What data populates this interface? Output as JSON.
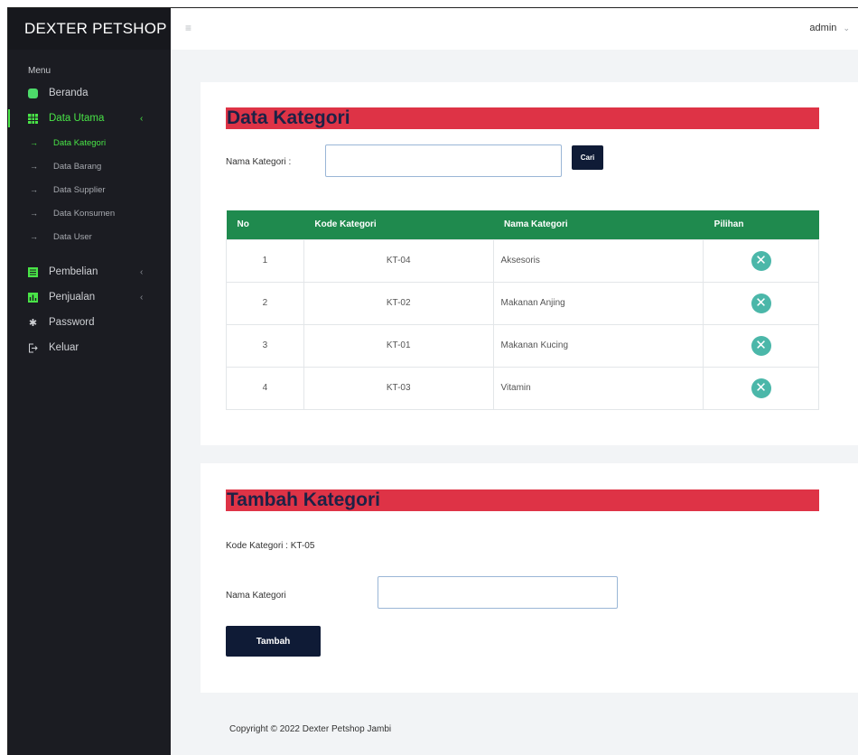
{
  "app": {
    "brand": "DEXTER PETSHOP",
    "menu_title": "Menu",
    "user": "admin"
  },
  "sidebar": {
    "items": [
      {
        "label": "Beranda",
        "icon": "dashboard-icon"
      },
      {
        "label": "Data Utama",
        "icon": "table-icon",
        "active": true
      },
      {
        "label": "Pembelian",
        "icon": "list-icon"
      },
      {
        "label": "Penjualan",
        "icon": "bar-chart-icon"
      },
      {
        "label": "Password",
        "icon": "gear-icon"
      },
      {
        "label": "Keluar",
        "icon": "logout-icon"
      }
    ],
    "sub_items": [
      {
        "label": "Data Kategori",
        "active": true
      },
      {
        "label": "Data Barang"
      },
      {
        "label": "Data Supplier"
      },
      {
        "label": "Data Konsumen"
      },
      {
        "label": "Data User"
      }
    ]
  },
  "data_kategori": {
    "title": "Data Kategori",
    "search_label": "Nama Kategori :",
    "search_value": "",
    "search_button": "Cari",
    "columns": [
      "No",
      "Kode Kategori",
      "Nama Kategori",
      "Pilihan"
    ],
    "rows": [
      {
        "no": "1",
        "kode": "KT-04",
        "nama": "Aksesoris"
      },
      {
        "no": "2",
        "kode": "KT-02",
        "nama": "Makanan Anjing"
      },
      {
        "no": "3",
        "kode": "KT-01",
        "nama": "Makanan Kucing"
      },
      {
        "no": "4",
        "kode": "KT-03",
        "nama": "Vitamin"
      }
    ]
  },
  "tambah_kategori": {
    "title": "Tambah Kategori",
    "kode_text": "Kode Kategori : KT-05",
    "nama_label": "Nama Kategori",
    "nama_value": "",
    "submit_button": "Tambah"
  },
  "footer": {
    "copyright": "Copyright © 2022 Dexter Petshop Jambi"
  },
  "colors": {
    "sidebar_bg": "#1b1c22",
    "accent_green": "#49e447",
    "title_red": "#de3346",
    "table_header": "#1f8a4e",
    "delete_teal": "#4bb7a9",
    "button_navy": "#0f1b36"
  }
}
